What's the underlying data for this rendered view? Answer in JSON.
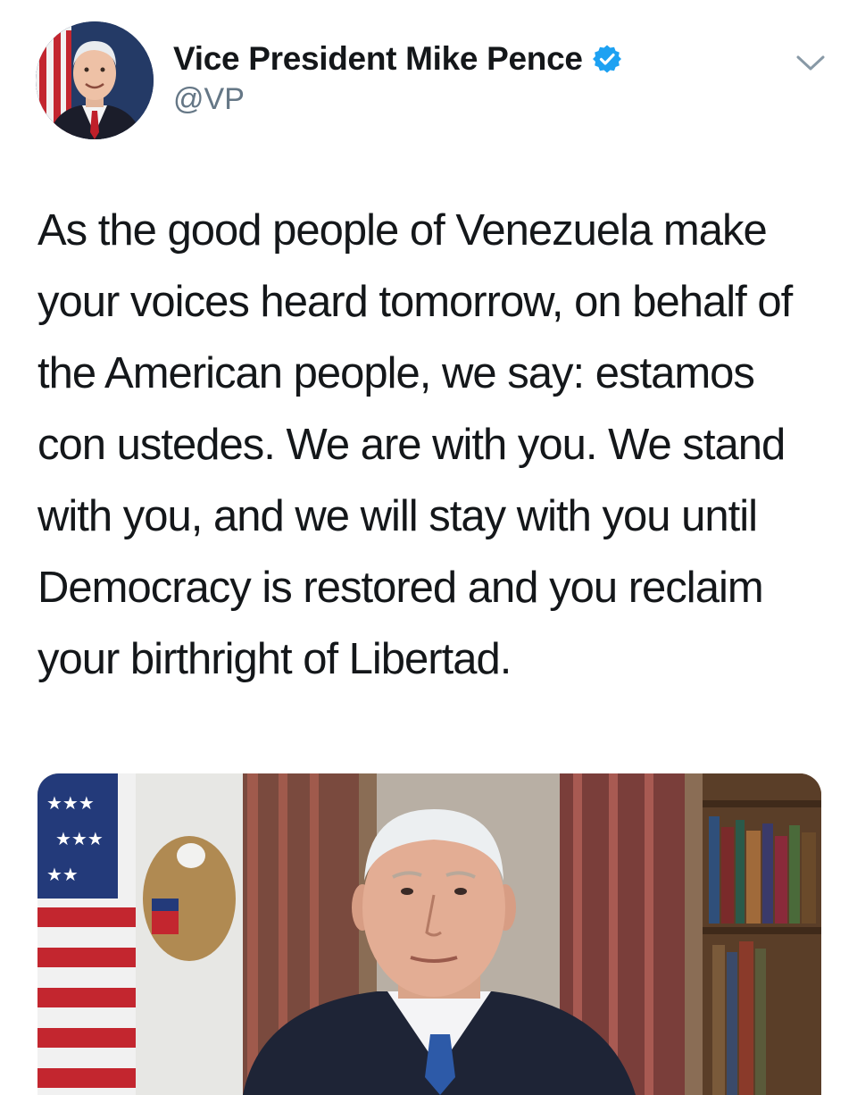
{
  "tweet": {
    "author": {
      "display_name": "Vice President Mike Pence",
      "handle": "@VP",
      "verified": true,
      "avatar": "profile-photo"
    },
    "text": "As the good people of Venezuela make your voices heard tomorrow, on behalf of the American people, we say: estamos con ustedes. We are with you. We stand with you, and we will stay with you until Democracy is restored and you reclaim your birthright of Libertad.",
    "media": {
      "type": "video-thumbnail"
    },
    "icons": {
      "verified": "verified-badge-icon",
      "more": "chevron-down-icon"
    },
    "colors": {
      "verified_badge": "#1da1f2",
      "handle": "#657786",
      "text": "#14171a"
    }
  }
}
